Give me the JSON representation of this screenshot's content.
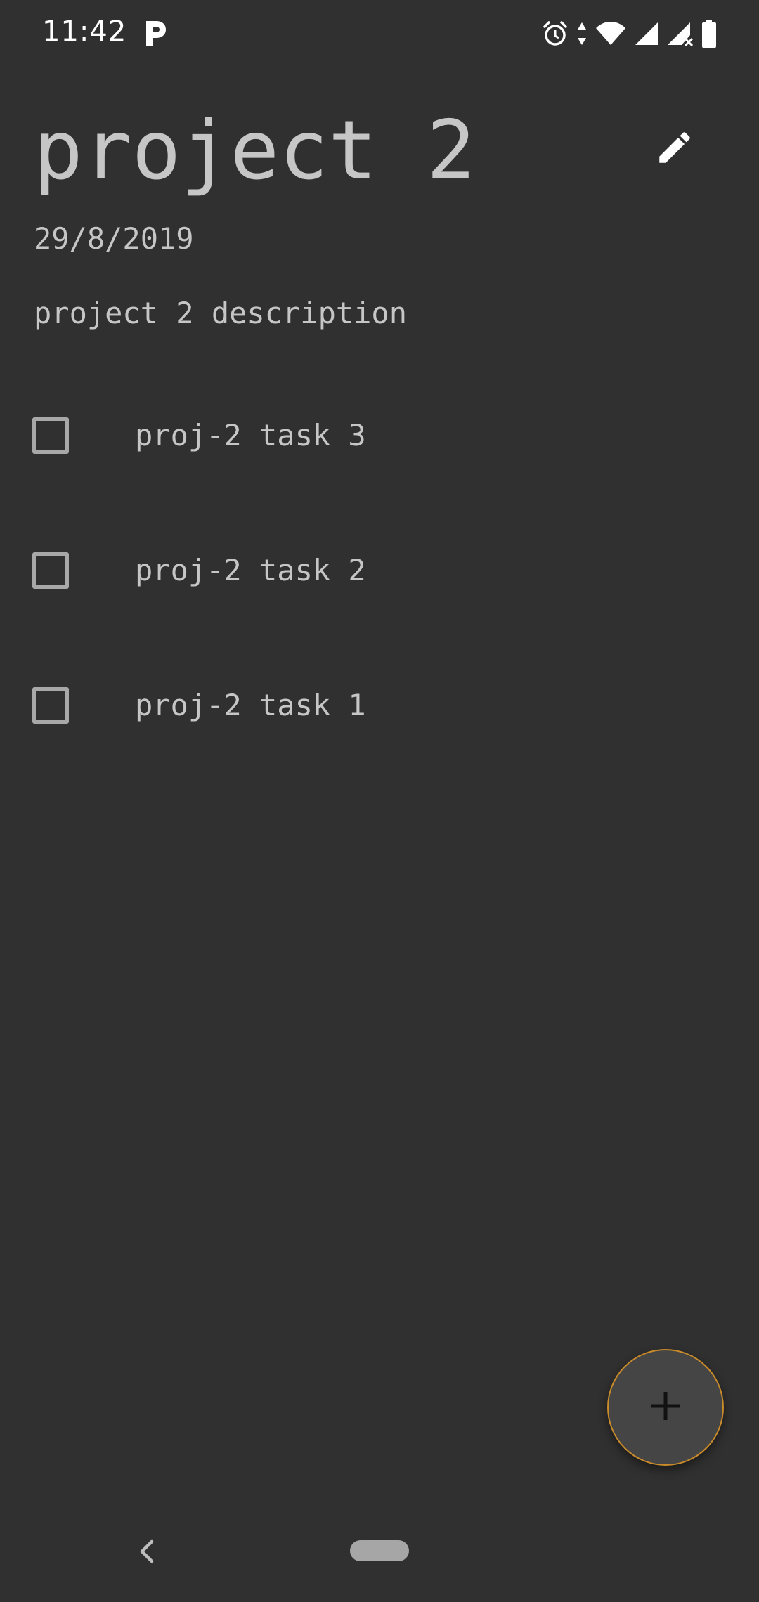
{
  "status_bar": {
    "time": "11:42",
    "left_icons": [
      "parking-p-icon"
    ],
    "right_icons": [
      "alarm-icon",
      "data-arrows-icon",
      "wifi-icon",
      "signal-icon",
      "signal-no-sim-icon",
      "battery-icon"
    ]
  },
  "project": {
    "title": "project 2",
    "date": "29/8/2019",
    "description": "project 2 description"
  },
  "actions": {
    "edit_icon": "pencil-icon",
    "add_icon": "plus-icon"
  },
  "tasks": [
    {
      "label": "proj-2 task 3",
      "checked": false
    },
    {
      "label": "proj-2 task 2",
      "checked": false
    },
    {
      "label": "proj-2 task 1",
      "checked": false
    }
  ],
  "colors": {
    "background": "#303030",
    "text": "#c6c6c6",
    "checkbox_border": "#a8a8a8",
    "fab_background": "#454545",
    "fab_border": "#c98a2a"
  },
  "navigation": {
    "back_icon": "back-chevron-icon",
    "home_icon": "home-pill-icon"
  }
}
